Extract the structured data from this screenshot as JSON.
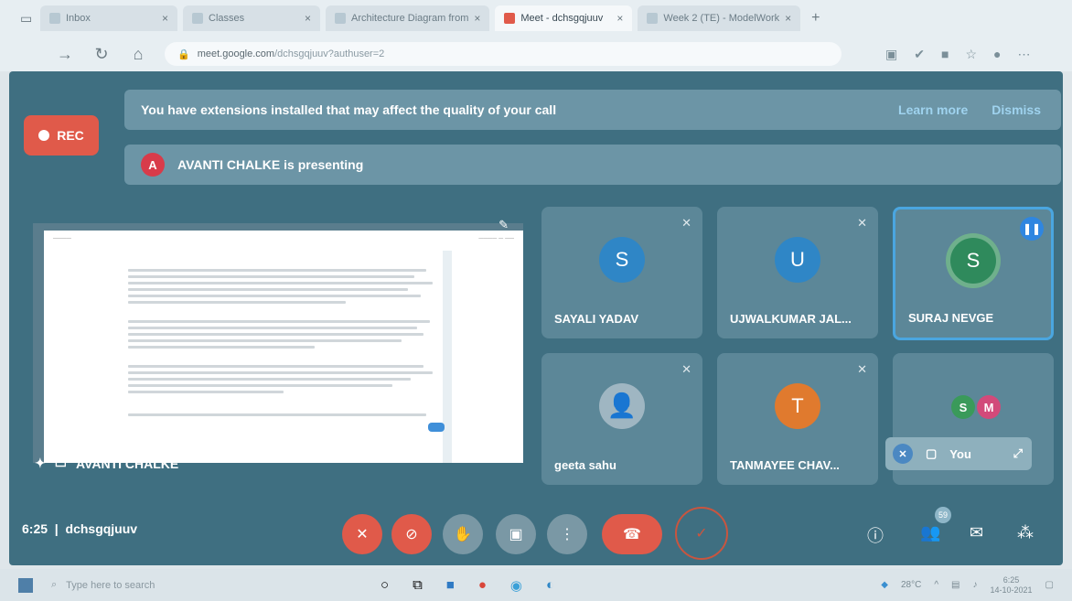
{
  "browser": {
    "tabs": [
      {
        "label": "Inbox"
      },
      {
        "label": "Classes"
      },
      {
        "label": "Architecture Diagram from"
      },
      {
        "label": "Meet - dchsgqjuuv"
      },
      {
        "label": "Week 2 (TE) - ModelWork"
      }
    ],
    "new_tab": "+",
    "url_host": "meet.google.com",
    "url_path": "/dchsgqjuuv?authuser=2"
  },
  "banner": {
    "message": "You have extensions installed that may affect the quality of your call",
    "learn_more": "Learn more",
    "dismiss": "Dismiss"
  },
  "rec_label": "REC",
  "presenting": {
    "avatar_letter": "A",
    "text": "AVANTI CHALKE is presenting"
  },
  "presentation": {
    "presenter_label": "AVANTI CHALKE"
  },
  "participants": [
    {
      "name": "SAYALI YADAV",
      "initial": "S",
      "color": "#2f86c6"
    },
    {
      "name": "UJWALKUMAR JAL...",
      "initial": "U",
      "color": "#2f86c6"
    },
    {
      "name": "SURAJ NEVGE",
      "initial": "S",
      "color": "#2f8a5c"
    },
    {
      "name": "geeta sahu",
      "initial": "",
      "color": "#6a8ea0"
    },
    {
      "name": "TANMAYEE CHAV...",
      "initial": "T",
      "color": "#e07a2e"
    }
  ],
  "others_tile": {
    "initials": [
      "S",
      "M"
    ],
    "colors": [
      "#3a9a5a",
      "#d24a7a"
    ],
    "self_label": "You"
  },
  "meeting": {
    "time": "6:25",
    "code": "dchsgqjuuv"
  },
  "participant_count": "59",
  "taskbar": {
    "search_placeholder": "Type here to search",
    "temperature": "28°C",
    "time": "6:25",
    "date": "14-10-2021"
  }
}
